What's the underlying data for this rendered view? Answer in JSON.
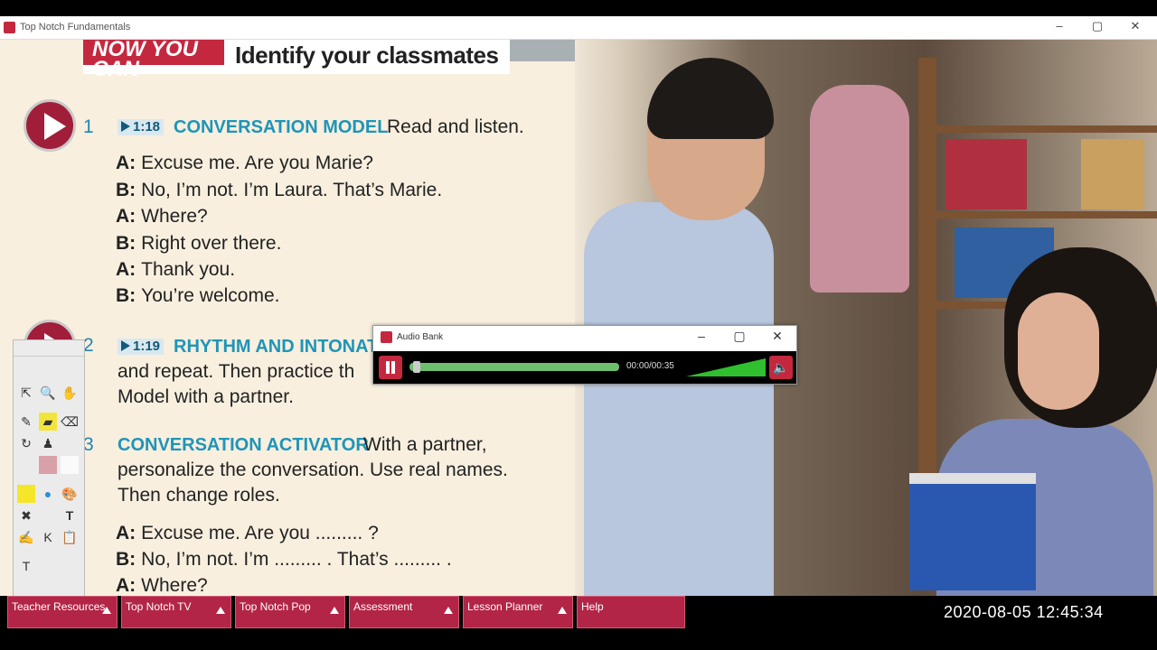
{
  "window": {
    "title": "Top Notch Fundamentals"
  },
  "lesson": {
    "badge": "NOW YOU CAN",
    "title": "Identify your classmates"
  },
  "section1": {
    "num": "1",
    "time": "1:18",
    "heading": "CONVERSATION MODEL",
    "instruction": "Read and listen."
  },
  "dialogue1": [
    {
      "spk": "A:",
      "line": "Excuse me. Are you Marie?"
    },
    {
      "spk": "B:",
      "line": "No, I’m not. I’m Laura. That’s Marie."
    },
    {
      "spk": "A:",
      "line": "Where?"
    },
    {
      "spk": "B:",
      "line": "Right over there."
    },
    {
      "spk": "A:",
      "line": "Thank you."
    },
    {
      "spk": "B:",
      "line": "You’re welcome."
    }
  ],
  "section2": {
    "num": "2",
    "time": "1:19",
    "heading": "RHYTHM AND INTONAT",
    "line2": "and repeat. Then practice th",
    "line3": "Model with a partner."
  },
  "section3": {
    "num": "3",
    "heading": "CONVERSATION ACTIVATOR",
    "instruction": "With a partner,",
    "line2": "personalize the conversation. Use real names.",
    "line3": "Then change roles."
  },
  "dialogue3": [
    {
      "spk": "A:",
      "line": "Excuse me. Are you  ......... ?"
    },
    {
      "spk": "B:",
      "line": "No, I’m not. I’m  ......... . That’s  ......... ."
    },
    {
      "spk": "A:",
      "line": "Where?"
    }
  ],
  "audio_player": {
    "title": "Audio Bank",
    "time": "00:00/00:35",
    "progress": 0.02,
    "volume": 1.0
  },
  "bottom_buttons": [
    "Teacher Resources",
    "Top Notch TV",
    "Top Notch Pop",
    "Assessment",
    "Lesson Planner",
    "Help"
  ],
  "clock": "2020-08-05  12:45:34",
  "colors": {
    "accent": "#c4283f",
    "heading": "#1e95b8",
    "button_bg": "#b22546"
  }
}
